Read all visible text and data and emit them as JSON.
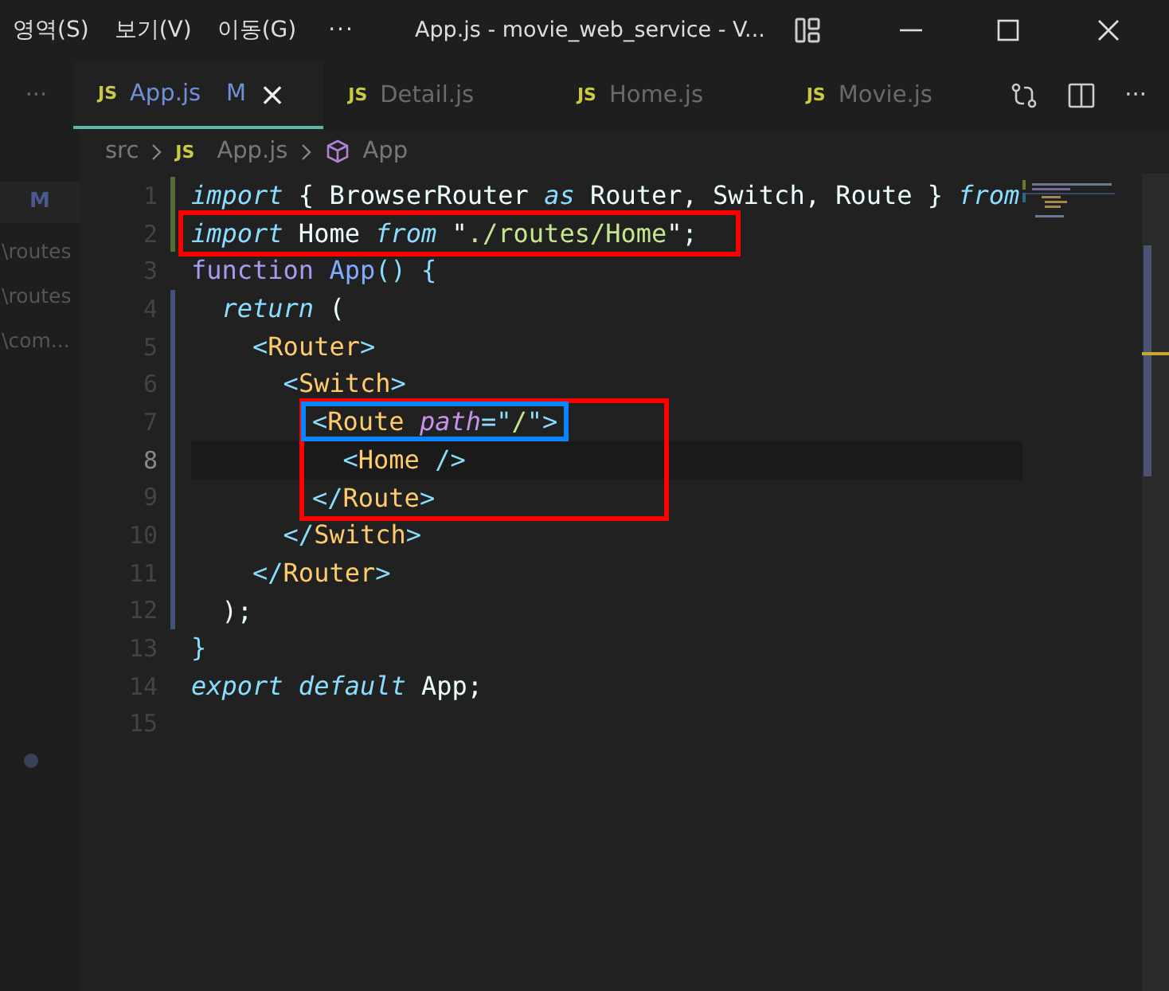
{
  "title_bar": {
    "menus": [
      "영역(S)",
      "보기(V)",
      "이동(G)"
    ],
    "more": "···",
    "title": "App.js - movie_web_service - V..."
  },
  "tabs_bar": {
    "overflow": "···",
    "tabs": [
      {
        "icon": "JS",
        "label": "App.js",
        "badge": "M",
        "close": "×",
        "selected": true
      },
      {
        "icon": "JS",
        "label": "Detail.js",
        "selected": false
      },
      {
        "icon": "JS",
        "label": "Home.js",
        "selected": false
      },
      {
        "icon": "JS",
        "label": "Movie.js",
        "selected": false
      }
    ],
    "more": "···"
  },
  "breadcrumb": [
    {
      "kind": "folder",
      "label": "src"
    },
    {
      "kind": "file",
      "icon": "JS",
      "label": "App.js"
    },
    {
      "kind": "symbol",
      "label": "App"
    }
  ],
  "explorer": {
    "badge": "M",
    "items": [
      "\\routes",
      "\\routes",
      "\\com..."
    ]
  },
  "editor": {
    "items": [
      {
        "kind": "line",
        "number": "1",
        "current": false,
        "color": "#556b38",
        "tokens": [
          {
            "kind": "keyword",
            "text": "import"
          },
          {
            "kind": "plain",
            "text": " { BrowserRouter "
          },
          {
            "kind": "keyword",
            "text": "as"
          },
          {
            "kind": "plain",
            "text": " Router, Switch, Route } "
          },
          {
            "kind": "keyword",
            "text": "from"
          }
        ]
      },
      {
        "kind": "group",
        "color": "#ff0000",
        "lines": [
          {
            "number": "2",
            "current": false,
            "color": "#556b38",
            "tokens": [
              {
                "kind": "keyword",
                "text": "import"
              },
              {
                "kind": "plain",
                "text": " Home "
              },
              {
                "kind": "keyword",
                "text": "from"
              },
              {
                "kind": "plain",
                "text": " \""
              },
              {
                "kind": "string",
                "text": "./routes/Home"
              },
              {
                "kind": "plain",
                "text": "\";"
              }
            ]
          }
        ]
      },
      {
        "kind": "line",
        "number": "3",
        "current": false,
        "tokens": [
          {
            "kind": "declaration",
            "text": "function "
          },
          {
            "kind": "function",
            "text": "App"
          },
          {
            "kind": "punctuation",
            "text": "() {"
          }
        ]
      },
      {
        "kind": "line",
        "number": "4",
        "current": false,
        "color": "#435278",
        "tokens": [
          {
            "kind": "keyword",
            "text": "  return"
          },
          {
            "kind": "plain",
            "text": " ("
          }
        ]
      },
      {
        "kind": "line",
        "number": "5",
        "current": false,
        "color": "#435278",
        "tokens": [
          {
            "kind": "punctuation",
            "text": "    <"
          },
          {
            "kind": "tag",
            "text": "Router"
          },
          {
            "kind": "punctuation",
            "text": ">"
          }
        ]
      },
      {
        "kind": "line",
        "number": "6",
        "current": false,
        "color": "#435278",
        "tokens": [
          {
            "kind": "punctuation",
            "text": "      <"
          },
          {
            "kind": "tag",
            "text": "Switch"
          },
          {
            "kind": "punctuation",
            "text": ">"
          }
        ]
      },
      {
        "kind": "group",
        "color": "#ff0000",
        "lines": [
          {
            "number": "7",
            "current": false,
            "color": "#435278",
            "tokens": [
              {
                "kind": "boxed",
                "color": "#0a84ff",
                "tokens": [
                  {
                    "kind": "punctuation",
                    "text": "<"
                  },
                  {
                    "kind": "tag",
                    "text": "Route "
                  },
                  {
                    "kind": "attribute",
                    "text": "path"
                  },
                  {
                    "kind": "punctuation",
                    "text": "=\""
                  },
                  {
                    "kind": "string",
                    "text": "/"
                  },
                  {
                    "kind": "punctuation",
                    "text": "\">"
                  }
                ]
              }
            ]
          },
          {
            "number": "8",
            "current": true,
            "color": "#435278",
            "tokens": [
              {
                "kind": "punctuation",
                "text": "  <"
              },
              {
                "kind": "tag",
                "text": "Home "
              },
              {
                "kind": "punctuation",
                "text": "/>"
              }
            ]
          },
          {
            "number": "9",
            "current": false,
            "color": "#435278",
            "tokens": [
              {
                "kind": "punctuation",
                "text": "</"
              },
              {
                "kind": "tag",
                "text": "Route"
              },
              {
                "kind": "punctuation",
                "text": ">"
              }
            ]
          }
        ]
      },
      {
        "kind": "line",
        "number": "10",
        "current": false,
        "color": "#435278",
        "tokens": [
          {
            "kind": "punctuation",
            "text": "      </"
          },
          {
            "kind": "tag",
            "text": "Switch"
          },
          {
            "kind": "punctuation",
            "text": ">"
          }
        ]
      },
      {
        "kind": "line",
        "number": "11",
        "current": false,
        "color": "#435278",
        "tokens": [
          {
            "kind": "punctuation",
            "text": "    </"
          },
          {
            "kind": "tag",
            "text": "Router"
          },
          {
            "kind": "punctuation",
            "text": ">"
          }
        ]
      },
      {
        "kind": "line",
        "number": "12",
        "current": false,
        "color": "#435278",
        "tokens": [
          {
            "kind": "plain",
            "text": "  );"
          }
        ]
      },
      {
        "kind": "line",
        "number": "13",
        "current": false,
        "tokens": [
          {
            "kind": "punctuation",
            "text": "}"
          }
        ]
      },
      {
        "kind": "line",
        "number": "14",
        "current": false,
        "tokens": [
          {
            "kind": "keyword",
            "text": "export default"
          },
          {
            "kind": "plain",
            "text": " App;"
          }
        ]
      },
      {
        "kind": "line",
        "number": "15",
        "current": false
      }
    ]
  }
}
